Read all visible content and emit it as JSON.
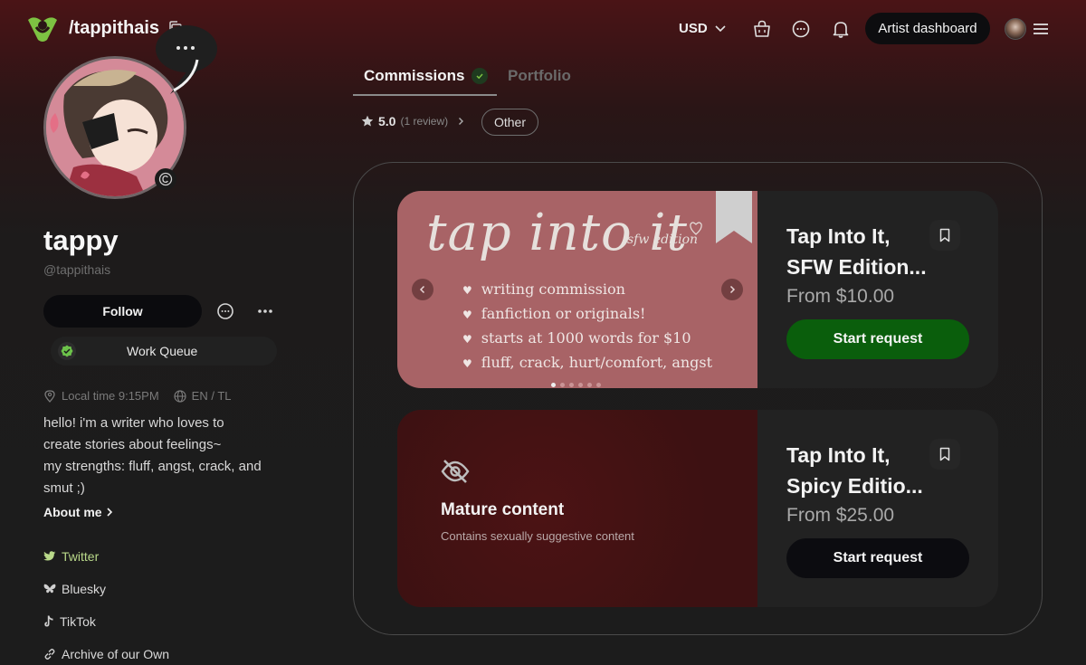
{
  "header": {
    "handle": "/tappithais",
    "currency": "USD",
    "artist_dashboard": "Artist dashboard"
  },
  "profile": {
    "name": "tappy",
    "at_handle": "@tappithais",
    "follow_label": "Follow",
    "work_queue_label": "Work Queue",
    "local_time": "Local time 9:15PM",
    "languages": "EN / TL",
    "bio_lines": [
      "hello! i'm a writer who loves to",
      "create stories about feelings~",
      "my strengths: fluff, angst, crack, and",
      "smut ;)"
    ],
    "about_label": "About me",
    "socials": [
      "Twitter",
      "Bluesky",
      "TikTok",
      "Archive of our Own"
    ]
  },
  "tabs": {
    "commissions": "Commissions",
    "portfolio": "Portfolio"
  },
  "rating": {
    "score": "5.0",
    "reviews": "(1 review)"
  },
  "filter": "Other",
  "cards": [
    {
      "title_line1": "Tap Into It,",
      "title_line2": "SFW Edition...",
      "price": "From $10.00",
      "button": "Start request",
      "art_title": "tap into it",
      "art_subtitle": "sfw edition",
      "art_lines": [
        "writing commission",
        "fanfiction or originals!",
        "starts at 1000 words for $10",
        "fluff, crack, hurt/comfort, angst"
      ]
    },
    {
      "title_line1": "Tap Into It,",
      "title_line2": "Spicy Editio...",
      "price": "From $25.00",
      "button": "Start request",
      "mature_title": "Mature content",
      "mature_subtitle": "Contains sexually suggestive content"
    }
  ],
  "colors": {
    "accent_green": "#0a5e0c",
    "brand_green": "#7dc242",
    "card_pink": "#a86366",
    "mature_red": "#3d1112"
  }
}
